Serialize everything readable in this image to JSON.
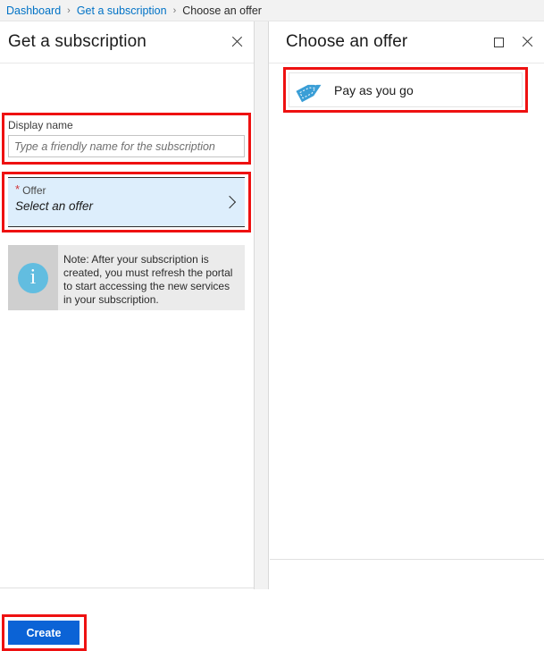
{
  "breadcrumb": {
    "items": [
      {
        "label": "Dashboard",
        "type": "link"
      },
      {
        "label": "Get a subscription",
        "type": "link"
      },
      {
        "label": "Choose an offer",
        "type": "current"
      }
    ],
    "separator": "›"
  },
  "left_panel": {
    "title": "Get a subscription",
    "close_icon": "close-icon",
    "display_name": {
      "label": "Display name",
      "value": "",
      "placeholder": "Type a friendly name for the subscription"
    },
    "offer": {
      "required_marker": "*",
      "label": "Offer",
      "value": "Select an offer",
      "chevron_icon": "chevron-right-icon"
    },
    "note": {
      "icon": "info-icon",
      "icon_glyph": "i",
      "text": "Note: After your subscription is created, you must refresh the portal to start accessing the new services in your subscription."
    },
    "create_button": "Create"
  },
  "right_panel": {
    "title": "Choose an offer",
    "maximize_icon": "maximize-icon",
    "close_icon": "close-icon",
    "offers": [
      {
        "label": "Pay as you go",
        "icon": "price-tag-icon"
      }
    ]
  },
  "colors": {
    "accent_blue": "#0b63d6",
    "link_blue": "#0072c6",
    "annotation_red": "#ee1111",
    "selected_field_blue": "#ddeefc",
    "info_icon_blue": "#62bde0",
    "tag_icon_blue": "#3a9ed6",
    "breadcrumb_background": "#f2f2f2",
    "note_background": "#ebebeb",
    "note_icon_background": "#cfcfcf"
  }
}
